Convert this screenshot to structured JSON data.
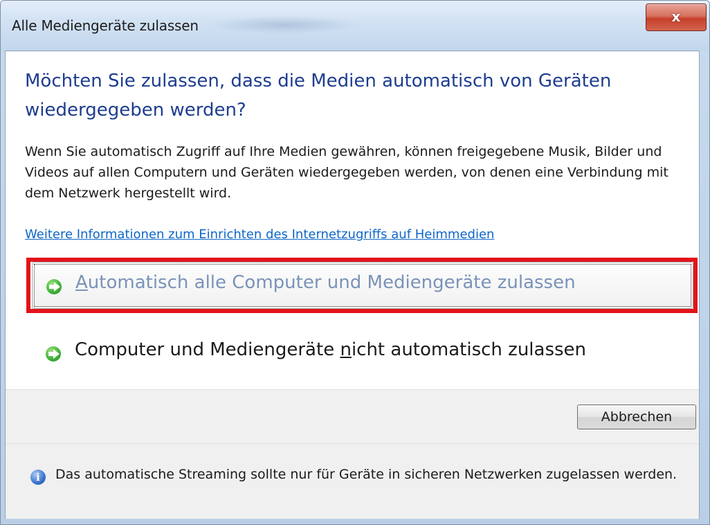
{
  "window": {
    "title": "Alle Mediengeräte zulassen",
    "close_label": "x"
  },
  "dialog": {
    "heading": "Möchten Sie zulassen, dass die Medien automatisch von Geräten wiedergegeben werden?",
    "description": "Wenn Sie automatisch Zugriff auf Ihre Medien gewähren, können freigegebene Musik, Bilder und Videos auf allen Computern und Geräten wiedergegeben werden, von denen eine Verbindung mit dem Netzwerk hergestellt wird.",
    "link": "Weitere Informationen zum Einrichten des Internetzugriffs auf Heimmedien",
    "options": [
      {
        "label_pre": "",
        "label_mnemonic": "A",
        "label_post": "utomatisch alle Computer und Mediengeräte zulassen",
        "icon": "green-arrow-icon"
      },
      {
        "label_pre": "Computer und Mediengeräte ",
        "label_mnemonic": "n",
        "label_post": "icht automatisch zulassen",
        "icon": "green-arrow-icon"
      }
    ],
    "cancel_label": "Abbrechen",
    "info_text": "Das automatische Streaming sollte nur für Geräte in sicheren Netzwerken zugelassen werden.",
    "info_icon": "info-icon"
  },
  "colors": {
    "heading": "#1e3d8f",
    "link": "#0e66c7",
    "highlight_border": "#e2141b"
  }
}
